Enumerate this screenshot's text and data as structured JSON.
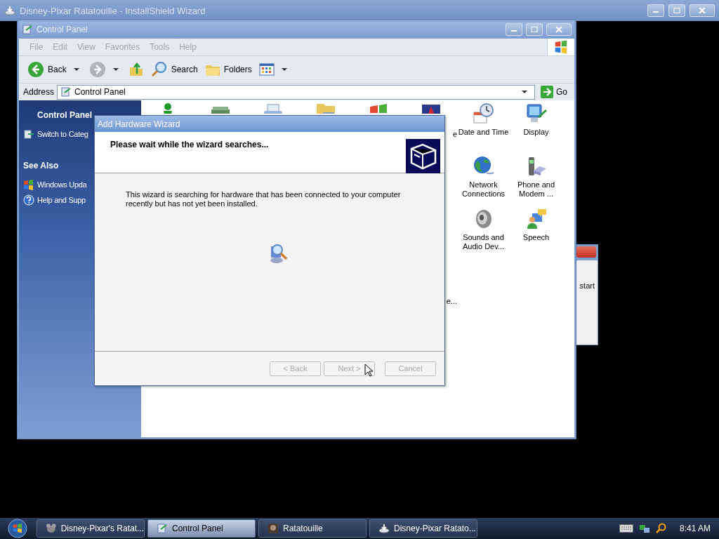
{
  "background_window": {
    "title": "Disney-Pixar Ratatouille - InstallShield Wizard"
  },
  "side_window": {
    "text": "start"
  },
  "control_panel": {
    "title": "Control Panel",
    "menu": [
      "File",
      "Edit",
      "View",
      "Favorites",
      "Tools",
      "Help"
    ],
    "toolbar": [
      {
        "kind": "back",
        "label": "Back",
        "disabled": false
      },
      {
        "kind": "forward",
        "disabled": true
      },
      {
        "kind": "up",
        "disabled": false
      },
      {
        "kind": "search",
        "label": "Search",
        "disabled": false
      },
      {
        "kind": "folders",
        "label": "Folders",
        "disabled": false
      },
      {
        "kind": "views",
        "disabled": false
      }
    ],
    "address": {
      "label": "Address",
      "value": "Control Panel",
      "go": "Go"
    },
    "sidebar": {
      "title": "Control Panel",
      "items": [
        {
          "kind": "switch",
          "label": "Switch to Categ"
        }
      ],
      "see_also": {
        "title": "See Also",
        "items": [
          {
            "kind": "update",
            "label": "Windows Upda"
          },
          {
            "kind": "help",
            "label": "Help and Supp"
          }
        ]
      }
    },
    "partial_icons": [
      {
        "kind": "person"
      },
      {
        "kind": "hardware"
      },
      {
        "kind": "printer"
      },
      {
        "kind": "folder"
      },
      {
        "kind": "windows"
      },
      {
        "kind": "fonts"
      }
    ],
    "label_fragments": [
      "e",
      "e..."
    ],
    "icons": [
      {
        "kind": "clock",
        "label": "Date and Time"
      },
      {
        "kind": "display",
        "label": "Display"
      },
      {
        "kind": "globe",
        "label": "Network Connections"
      },
      {
        "kind": "phone",
        "label": "Phone and Modem ..."
      },
      {
        "kind": "speaker",
        "label": "Sounds and Audio Dev..."
      },
      {
        "kind": "speech",
        "label": "Speech"
      }
    ]
  },
  "wizard": {
    "title": "Add Hardware Wizard",
    "heading": "Please wait while the wizard searches...",
    "message": "This wizard is searching for hardware that has been connected to your computer recently but has not yet been installed.",
    "buttons": [
      {
        "label": "< Back",
        "disabled": true
      },
      {
        "label": "Next >",
        "disabled": true
      },
      {
        "label": "Cancel",
        "disabled": true
      }
    ]
  },
  "taskbar": {
    "buttons": [
      {
        "kind": "rat",
        "label": "Disney-Pixar's Ratat...",
        "selected": false
      },
      {
        "kind": "panel",
        "label": "Control Panel",
        "selected": true
      },
      {
        "kind": "movie",
        "label": "Ratatouille",
        "selected": false
      },
      {
        "kind": "installer",
        "label": "Disney-Pixar Ratato...",
        "selected": false
      }
    ],
    "clock": "8:41 AM"
  }
}
